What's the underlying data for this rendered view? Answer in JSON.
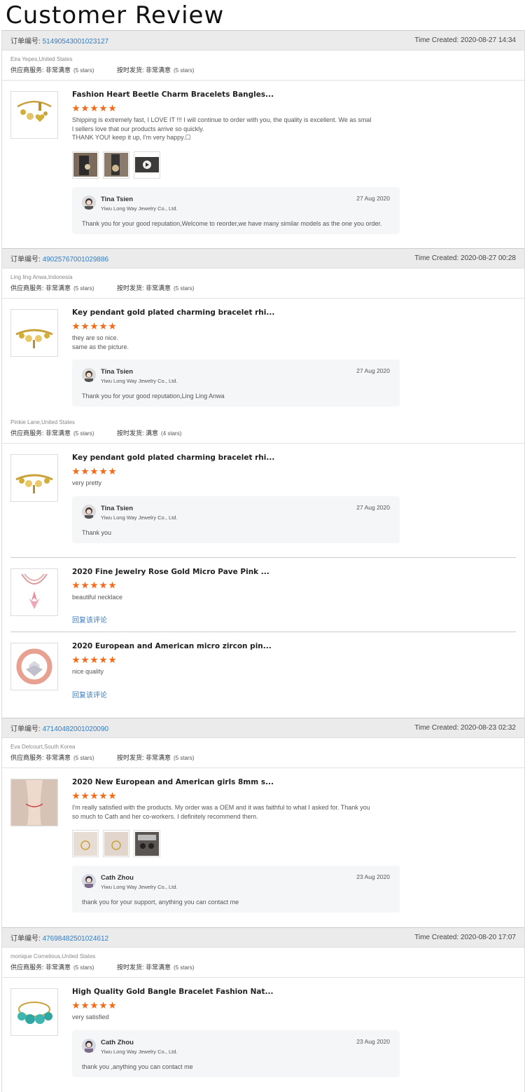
{
  "page_title": "Customer Review",
  "order_label": "订单编号:",
  "time_label": "Time Created:",
  "service_label": "供应商服务:",
  "shipping_label": "按时发货:",
  "reply_label": "回复该评论",
  "colors": {
    "accent": "#2f7ec9",
    "star": "#f26b1a",
    "header_bg": "#ebebeb",
    "reply_bg": "#f5f6f8"
  },
  "orders": [
    {
      "number": "51490543001023127",
      "time": "2020-08-27 14:34",
      "buyers": [
        {
          "name": "Eira Yepes,United States",
          "service": "非常满意",
          "service_stars": "(5 stars)",
          "shipping": "非常满意",
          "shipping_stars": "(5 stars)",
          "items": [
            {
              "title": "Fashion Heart Beetle Charm Bracelets Bangles...",
              "review": "Shipping is extremely fast, I LOVE IT !!!  I will continue to order with you, the quality is excellent.  We as smal\nl sellers love that our products arrive so quickly.\n  THANK YOU!  keep it up, I'm very happy.☐",
              "photos": 3,
              "reply": {
                "name": "Tina Tsien",
                "company": "Yiwu Long Way Jewelry Co., Ltd.",
                "date": "27 Aug 2020",
                "text": "Thank you for your good reputation,Welcome to reorder,we have many similar models as the one you order."
              }
            }
          ]
        }
      ]
    },
    {
      "number": "49025767001029886",
      "time": "2020-08-27 00:28",
      "buyers": [
        {
          "name": "Ling ling Anwa,Indonesia",
          "service": "非常满意",
          "service_stars": "(5 stars)",
          "shipping": "非常满意",
          "shipping_stars": "(5 stars)",
          "items": [
            {
              "title": "Key pendant gold plated charming bracelet rhi...",
              "review": "they are so nice.\nsame as the picture.",
              "reply": {
                "name": "Tina Tsien",
                "company": "Yiwu Long Way Jewelry Co., Ltd.",
                "date": "27 Aug 2020",
                "text": "Thank you for your good reputation,Ling Ling Anwa"
              }
            }
          ]
        },
        {
          "name": "Pinkie Lane,United States",
          "service": "非常满意",
          "service_stars": "(5 stars)",
          "shipping": "满意",
          "shipping_stars": "(4 stars)",
          "items": [
            {
              "title": "Key pendant gold plated charming bracelet rhi...",
              "review": "very pretty",
              "reply": {
                "name": "Tina Tsien",
                "company": "Yiwu Long Way Jewelry Co., Ltd.",
                "date": "27 Aug 2020",
                "text": "Thank you"
              }
            },
            {
              "title": "2020 Fine Jewelry Rose Gold Micro Pave Pink ...",
              "review": "beautiful necklace"
            },
            {
              "title": "2020 European and American micro zircon pin...",
              "review": "nice quality"
            }
          ]
        }
      ]
    },
    {
      "number": "47140482001020090",
      "time": "2020-08-23 02:32",
      "buyers": [
        {
          "name": "Eva Delcourt,South Korea",
          "service": "非常满意",
          "service_stars": "(5 stars)",
          "shipping": "非常满意",
          "shipping_stars": "(5 stars)",
          "items": [
            {
              "title": "2020 New European and American girls 8mm s...",
              "review": "I'm really satisfied with the products. My order was a OEM and it was faithful to what I asked for. Thank you\nso much to Cath and her co-workers. I definitely recommend them.",
              "photos": 3,
              "reply": {
                "name": "Cath Zhou",
                "company": "Yiwu Long Way Jewelry Co., Ltd.",
                "date": "23 Aug 2020",
                "text": "thank you for your support, anything you can contact me"
              }
            }
          ]
        }
      ]
    },
    {
      "number": "47698482501024612",
      "time": "2020-08-20 17:07",
      "buyers": [
        {
          "name": "monique Cornelious,United States",
          "service": "非常满意",
          "service_stars": "(5 stars)",
          "shipping": "非常满意",
          "shipping_stars": "(5 stars)",
          "items": [
            {
              "title": "High Quality Gold Bangle Bracelet Fashion Nat...",
              "review": "very satisfied",
              "reply": {
                "name": "Cath Zhou",
                "company": "Yiwu Long Way Jewelry Co., Ltd.",
                "date": "23 Aug 2020",
                "text": "thank you ,anything you can contact me"
              }
            }
          ]
        }
      ]
    }
  ]
}
